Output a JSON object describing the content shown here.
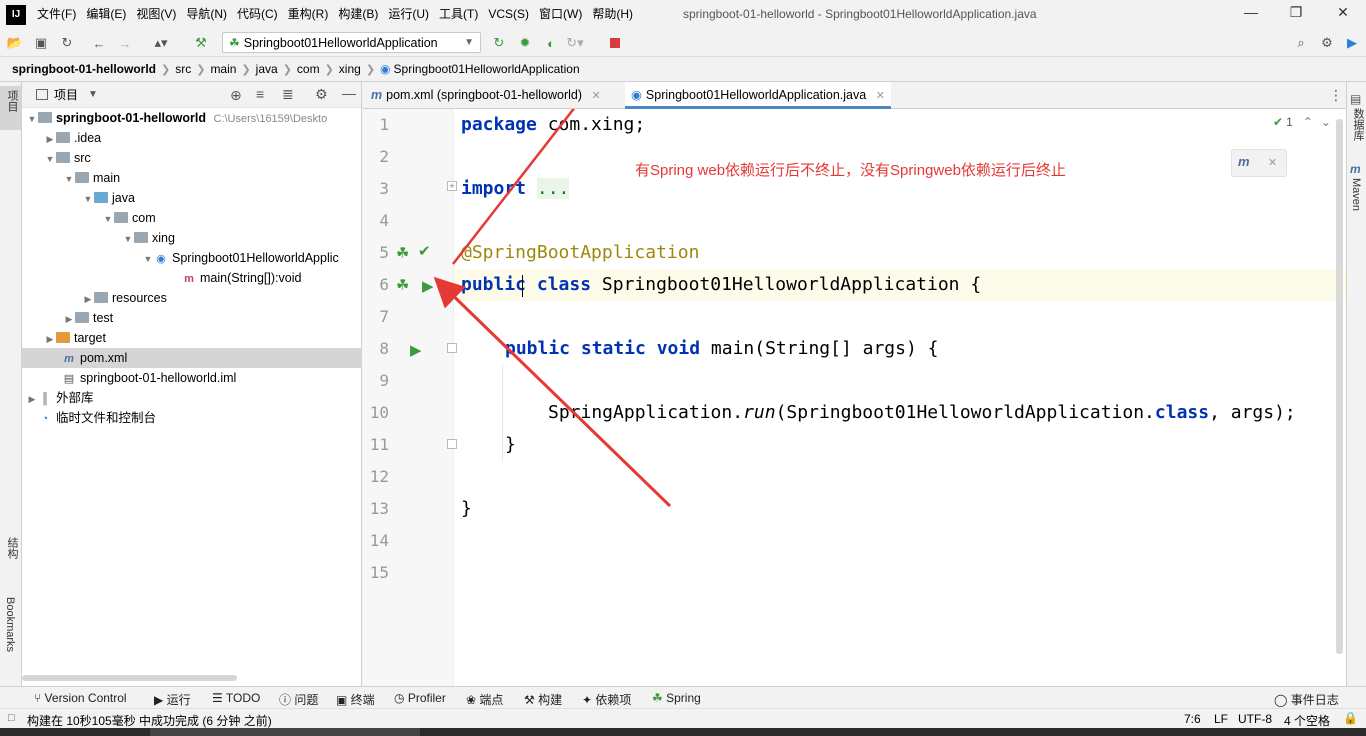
{
  "menu": [
    "文件(F)",
    "编辑(E)",
    "视图(V)",
    "导航(N)",
    "代码(C)",
    "重构(R)",
    "构建(B)",
    "运行(U)",
    "工具(T)",
    "VCS(S)",
    "窗口(W)",
    "帮助(H)"
  ],
  "window_title": "springboot-01-helloworld - Springboot01HelloworldApplication.java",
  "run_config": "Springboot01HelloworldApplication",
  "breadcrumb": [
    "springboot-01-helloworld",
    "src",
    "main",
    "java",
    "com",
    "xing",
    "Springboot01HelloworldApplication"
  ],
  "left_stripe": {
    "project": "项目",
    "structure": "结构",
    "bookmarks": "Bookmarks"
  },
  "right_stripe": {
    "database": "数据库",
    "maven": "Maven"
  },
  "project_panel": {
    "title": "项目",
    "tree": [
      {
        "label": "springboot-01-helloworld",
        "hint": "C:\\Users\\16159\\Deskto"
      },
      {
        "label": ".idea"
      },
      {
        "label": "src"
      },
      {
        "label": "main"
      },
      {
        "label": "java"
      },
      {
        "label": "com"
      },
      {
        "label": "xing"
      },
      {
        "label": "Springboot01HelloworldApplic"
      },
      {
        "label": "main(String[]):void"
      },
      {
        "label": "resources"
      },
      {
        "label": "test"
      },
      {
        "label": "target"
      },
      {
        "label": "pom.xml"
      },
      {
        "label": "springboot-01-helloworld.iml"
      },
      {
        "label": "外部库"
      },
      {
        "label": "临时文件和控制台"
      }
    ]
  },
  "tabs": [
    "pom.xml (springboot-01-helloworld)",
    "Springboot01HelloworldApplication.java"
  ],
  "editor": {
    "line_numbers": [
      "1",
      "2",
      "3",
      "4",
      "5",
      "6",
      "7",
      "8",
      "9",
      "10",
      "11",
      "12",
      "13",
      "14",
      "15"
    ],
    "annotation_note": "有Spring web依赖运行后不终止，没有Springweb依赖运行后终止",
    "inspection_count": "1",
    "code": {
      "l1a": "package ",
      "l1b": "com.xing;",
      "l3a": "import ",
      "l3b": "...",
      "l6": "@SpringBootApplication",
      "l7a": "public ",
      "l7b": "class ",
      "l7c": "Springboot01HelloworldApplication {",
      "l9a": "public static void ",
      "l9b": "main(String[] args) {",
      "l11a": "SpringApplication.",
      "l11b": "run",
      "l11c": "(Springboot01HelloworldApplication.",
      "l11d": "class",
      "l11e": ", args);",
      "l12": "}",
      "l14": "}"
    }
  },
  "bottom_tools": [
    "Version Control",
    "运行",
    "TODO",
    "问题",
    "终端",
    "Profiler",
    "端点",
    "构建",
    "依赖项",
    "Spring"
  ],
  "event_log": "事件日志",
  "status": {
    "message": "构建在 10秒105毫秒 中成功完成 (6 分钟 之前)",
    "position": "7:6",
    "line_sep": "LF",
    "encoding": "UTF-8",
    "indent": "4 个空格"
  },
  "colors": {
    "keyword": "#0033b3",
    "annotation": "#9e880d",
    "note": "#e53935",
    "run": "#3c9a3c",
    "stop": "#d93a3a"
  }
}
